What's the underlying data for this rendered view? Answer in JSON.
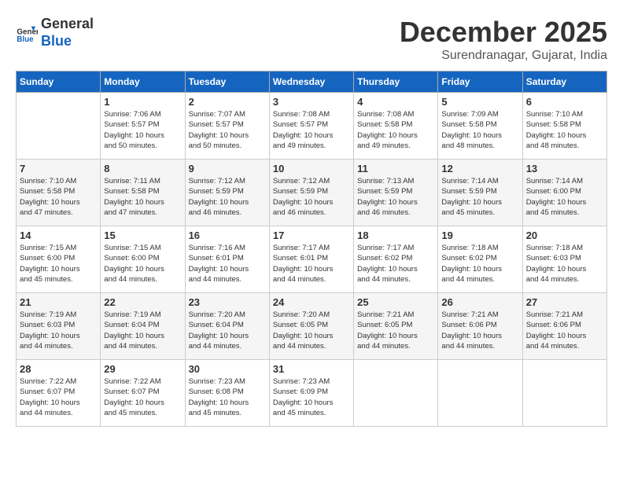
{
  "header": {
    "logo_line1": "General",
    "logo_line2": "Blue",
    "month_title": "December 2025",
    "location": "Surendranagar, Gujarat, India"
  },
  "days_of_week": [
    "Sunday",
    "Monday",
    "Tuesday",
    "Wednesday",
    "Thursday",
    "Friday",
    "Saturday"
  ],
  "weeks": [
    [
      {
        "day": "",
        "info": ""
      },
      {
        "day": "1",
        "info": "Sunrise: 7:06 AM\nSunset: 5:57 PM\nDaylight: 10 hours\nand 50 minutes."
      },
      {
        "day": "2",
        "info": "Sunrise: 7:07 AM\nSunset: 5:57 PM\nDaylight: 10 hours\nand 50 minutes."
      },
      {
        "day": "3",
        "info": "Sunrise: 7:08 AM\nSunset: 5:57 PM\nDaylight: 10 hours\nand 49 minutes."
      },
      {
        "day": "4",
        "info": "Sunrise: 7:08 AM\nSunset: 5:58 PM\nDaylight: 10 hours\nand 49 minutes."
      },
      {
        "day": "5",
        "info": "Sunrise: 7:09 AM\nSunset: 5:58 PM\nDaylight: 10 hours\nand 48 minutes."
      },
      {
        "day": "6",
        "info": "Sunrise: 7:10 AM\nSunset: 5:58 PM\nDaylight: 10 hours\nand 48 minutes."
      }
    ],
    [
      {
        "day": "7",
        "info": "Sunrise: 7:10 AM\nSunset: 5:58 PM\nDaylight: 10 hours\nand 47 minutes."
      },
      {
        "day": "8",
        "info": "Sunrise: 7:11 AM\nSunset: 5:58 PM\nDaylight: 10 hours\nand 47 minutes."
      },
      {
        "day": "9",
        "info": "Sunrise: 7:12 AM\nSunset: 5:59 PM\nDaylight: 10 hours\nand 46 minutes."
      },
      {
        "day": "10",
        "info": "Sunrise: 7:12 AM\nSunset: 5:59 PM\nDaylight: 10 hours\nand 46 minutes."
      },
      {
        "day": "11",
        "info": "Sunrise: 7:13 AM\nSunset: 5:59 PM\nDaylight: 10 hours\nand 46 minutes."
      },
      {
        "day": "12",
        "info": "Sunrise: 7:14 AM\nSunset: 5:59 PM\nDaylight: 10 hours\nand 45 minutes."
      },
      {
        "day": "13",
        "info": "Sunrise: 7:14 AM\nSunset: 6:00 PM\nDaylight: 10 hours\nand 45 minutes."
      }
    ],
    [
      {
        "day": "14",
        "info": "Sunrise: 7:15 AM\nSunset: 6:00 PM\nDaylight: 10 hours\nand 45 minutes."
      },
      {
        "day": "15",
        "info": "Sunrise: 7:15 AM\nSunset: 6:00 PM\nDaylight: 10 hours\nand 44 minutes."
      },
      {
        "day": "16",
        "info": "Sunrise: 7:16 AM\nSunset: 6:01 PM\nDaylight: 10 hours\nand 44 minutes."
      },
      {
        "day": "17",
        "info": "Sunrise: 7:17 AM\nSunset: 6:01 PM\nDaylight: 10 hours\nand 44 minutes."
      },
      {
        "day": "18",
        "info": "Sunrise: 7:17 AM\nSunset: 6:02 PM\nDaylight: 10 hours\nand 44 minutes."
      },
      {
        "day": "19",
        "info": "Sunrise: 7:18 AM\nSunset: 6:02 PM\nDaylight: 10 hours\nand 44 minutes."
      },
      {
        "day": "20",
        "info": "Sunrise: 7:18 AM\nSunset: 6:03 PM\nDaylight: 10 hours\nand 44 minutes."
      }
    ],
    [
      {
        "day": "21",
        "info": "Sunrise: 7:19 AM\nSunset: 6:03 PM\nDaylight: 10 hours\nand 44 minutes."
      },
      {
        "day": "22",
        "info": "Sunrise: 7:19 AM\nSunset: 6:04 PM\nDaylight: 10 hours\nand 44 minutes."
      },
      {
        "day": "23",
        "info": "Sunrise: 7:20 AM\nSunset: 6:04 PM\nDaylight: 10 hours\nand 44 minutes."
      },
      {
        "day": "24",
        "info": "Sunrise: 7:20 AM\nSunset: 6:05 PM\nDaylight: 10 hours\nand 44 minutes."
      },
      {
        "day": "25",
        "info": "Sunrise: 7:21 AM\nSunset: 6:05 PM\nDaylight: 10 hours\nand 44 minutes."
      },
      {
        "day": "26",
        "info": "Sunrise: 7:21 AM\nSunset: 6:06 PM\nDaylight: 10 hours\nand 44 minutes."
      },
      {
        "day": "27",
        "info": "Sunrise: 7:21 AM\nSunset: 6:06 PM\nDaylight: 10 hours\nand 44 minutes."
      }
    ],
    [
      {
        "day": "28",
        "info": "Sunrise: 7:22 AM\nSunset: 6:07 PM\nDaylight: 10 hours\nand 44 minutes."
      },
      {
        "day": "29",
        "info": "Sunrise: 7:22 AM\nSunset: 6:07 PM\nDaylight: 10 hours\nand 45 minutes."
      },
      {
        "day": "30",
        "info": "Sunrise: 7:23 AM\nSunset: 6:08 PM\nDaylight: 10 hours\nand 45 minutes."
      },
      {
        "day": "31",
        "info": "Sunrise: 7:23 AM\nSunset: 6:09 PM\nDaylight: 10 hours\nand 45 minutes."
      },
      {
        "day": "",
        "info": ""
      },
      {
        "day": "",
        "info": ""
      },
      {
        "day": "",
        "info": ""
      }
    ]
  ]
}
